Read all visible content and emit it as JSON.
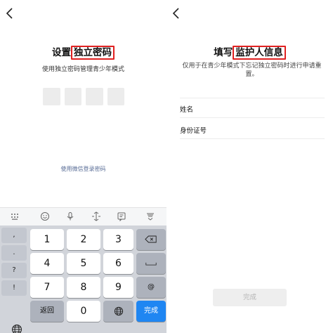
{
  "left": {
    "title_prefix": "设置",
    "title_highlight": "独立密码",
    "subtitle": "使用独立密码管理青少年模式",
    "wechat_link": "使用微信登录密码",
    "keyboard": {
      "symbols": [
        ",",
        ".",
        "?",
        "!"
      ],
      "keys": [
        "1",
        "2",
        "3",
        "4",
        "5",
        "6",
        "7",
        "8",
        "9",
        "0"
      ],
      "return_label": "返回",
      "at_label": "@",
      "done_label": "完成"
    }
  },
  "right": {
    "title_prefix": "填写",
    "title_highlight": "监护人信息",
    "hint": "仅用于在青少年模式下忘记独立密码时进行申请重置。",
    "name_label": "姓名",
    "id_label": "身份证号",
    "done_button": "完成"
  },
  "colors": {
    "highlight_border": "#e02020",
    "link": "#576b95",
    "keyboard_bg": "#d1d4da",
    "done_key": "#1f86f2"
  }
}
